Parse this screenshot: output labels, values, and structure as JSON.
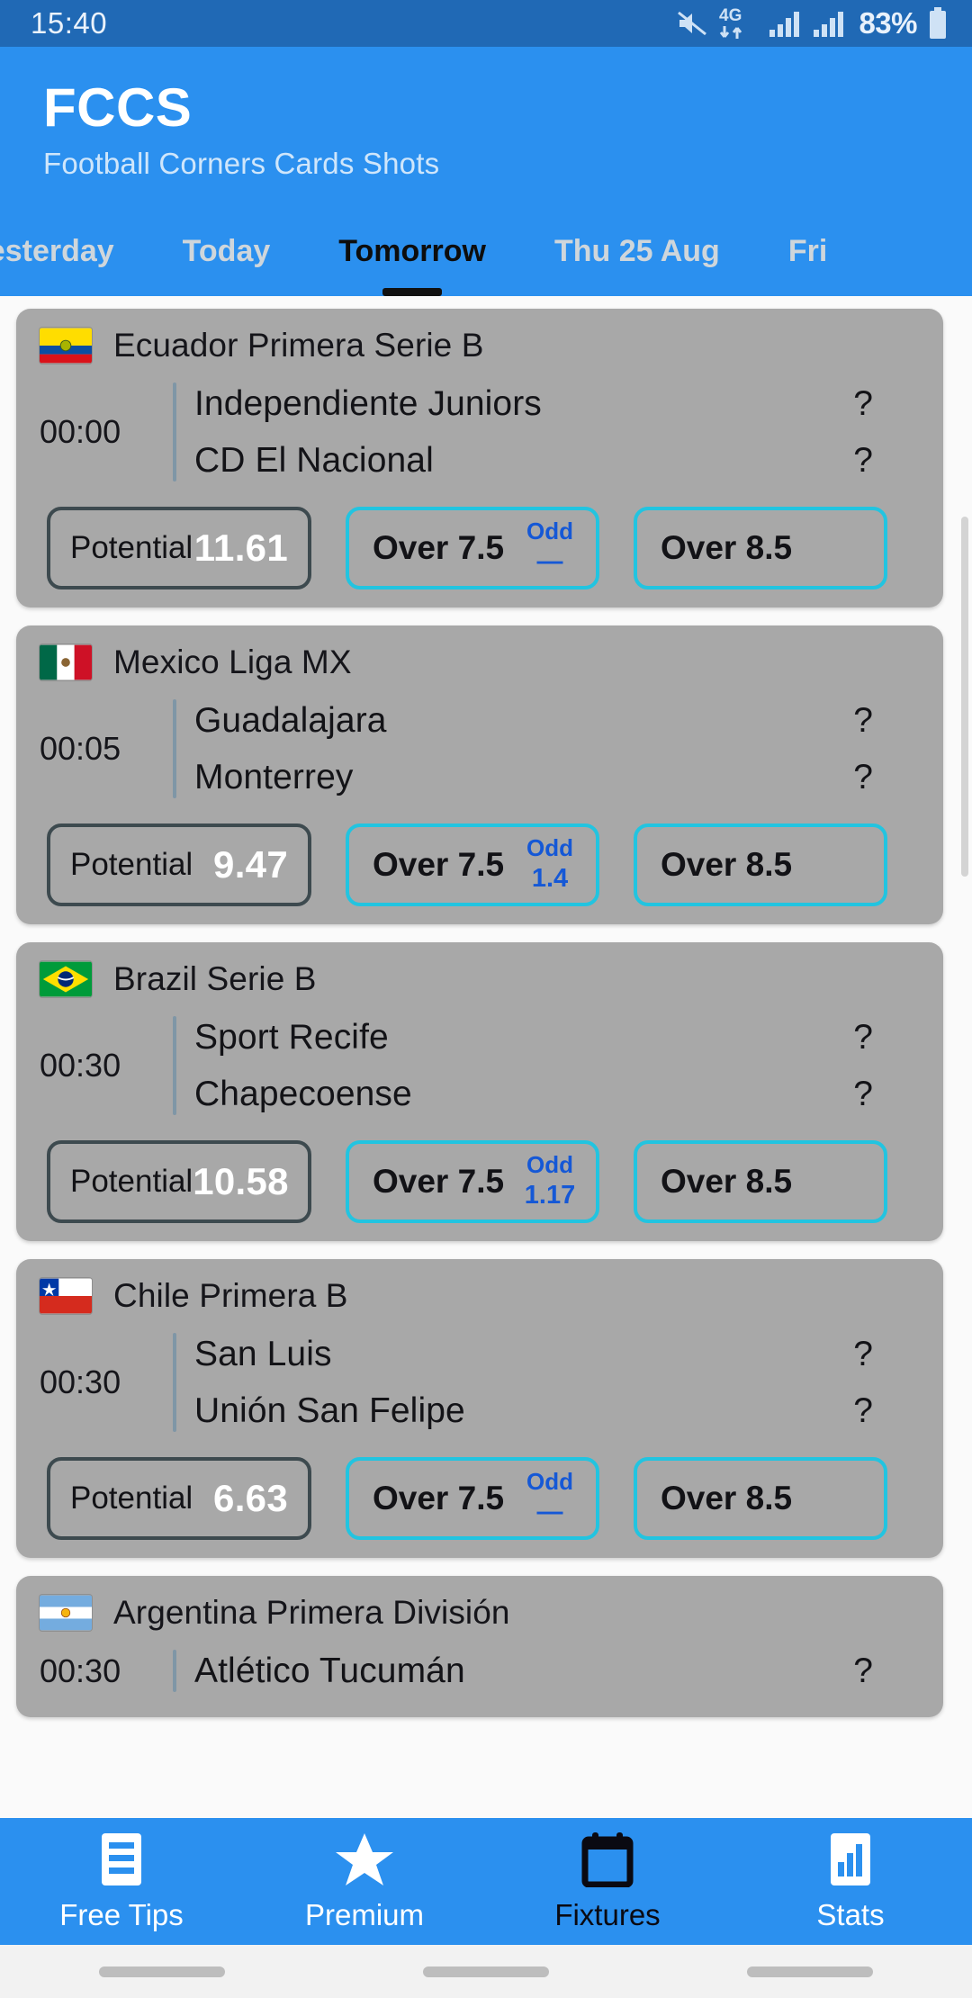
{
  "status_bar": {
    "time": "15:40",
    "network": "4G",
    "battery_percent": "83%",
    "icons": [
      "mute-icon",
      "network-4g-icon",
      "signal-bars-icon",
      "signal-bars-2-icon",
      "battery-icon"
    ]
  },
  "header": {
    "title": "FCCS",
    "subtitle": "Football Corners Cards Shots"
  },
  "tabs": [
    {
      "label": "Yesterday",
      "active": false
    },
    {
      "label": "Today",
      "active": false
    },
    {
      "label": "Tomorrow",
      "active": true
    },
    {
      "label": "Thu 25 Aug",
      "active": false
    },
    {
      "label": "Fri",
      "active": false
    }
  ],
  "matches": [
    {
      "league": "Ecuador Primera Serie B",
      "flag": "ecuador-flag",
      "time": "00:00",
      "home_team": "Independiente Juniors",
      "away_team": "CD El Nacional",
      "home_score": "?",
      "away_score": "?",
      "potential_label": "Potential",
      "potential_value": "11.61",
      "bet1_label": "Over 7.5",
      "bet1_odd_title": "Odd",
      "bet1_odd_value": "—",
      "bet2_label": "Over 8.5"
    },
    {
      "league": "Mexico Liga MX",
      "flag": "mexico-flag",
      "time": "00:05",
      "home_team": "Guadalajara",
      "away_team": "Monterrey",
      "home_score": "?",
      "away_score": "?",
      "potential_label": "Potential",
      "potential_value": "9.47",
      "bet1_label": "Over 7.5",
      "bet1_odd_title": "Odd",
      "bet1_odd_value": "1.4",
      "bet2_label": "Over 8.5"
    },
    {
      "league": "Brazil Serie B",
      "flag": "brazil-flag",
      "time": "00:30",
      "home_team": "Sport Recife",
      "away_team": "Chapecoense",
      "home_score": "?",
      "away_score": "?",
      "potential_label": "Potential",
      "potential_value": "10.58",
      "bet1_label": "Over 7.5",
      "bet1_odd_title": "Odd",
      "bet1_odd_value": "1.17",
      "bet2_label": "Over 8.5"
    },
    {
      "league": "Chile Primera B",
      "flag": "chile-flag",
      "time": "00:30",
      "home_team": "San Luis",
      "away_team": "Unión San Felipe",
      "home_score": "?",
      "away_score": "?",
      "potential_label": "Potential",
      "potential_value": "6.63",
      "bet1_label": "Over 7.5",
      "bet1_odd_title": "Odd",
      "bet1_odd_value": "—",
      "bet2_label": "Over 8.5"
    },
    {
      "league": "Argentina Primera División",
      "flag": "argentina-flag",
      "time": "00:30",
      "home_team": "Atlético Tucumán",
      "away_team": "",
      "home_score": "?",
      "away_score": "",
      "potential_label": "",
      "potential_value": "",
      "bet1_label": "",
      "bet1_odd_title": "",
      "bet1_odd_value": "",
      "bet2_label": ""
    }
  ],
  "bottom_nav": [
    {
      "label": "Free Tips",
      "icon": "list-icon",
      "active": false
    },
    {
      "label": "Premium",
      "icon": "star-icon",
      "active": false
    },
    {
      "label": "Fixtures",
      "icon": "calendar-icon",
      "active": true
    },
    {
      "label": "Stats",
      "icon": "bar-chart-icon",
      "active": false
    }
  ],
  "colors": {
    "status_bar_bg": "#2069b5",
    "header_bg": "#2b90ef",
    "card_bg": "#a8a8a8",
    "accent_cyan": "#22c4e0",
    "odd_blue": "#1558d6",
    "page_bg": "#fafafa"
  }
}
